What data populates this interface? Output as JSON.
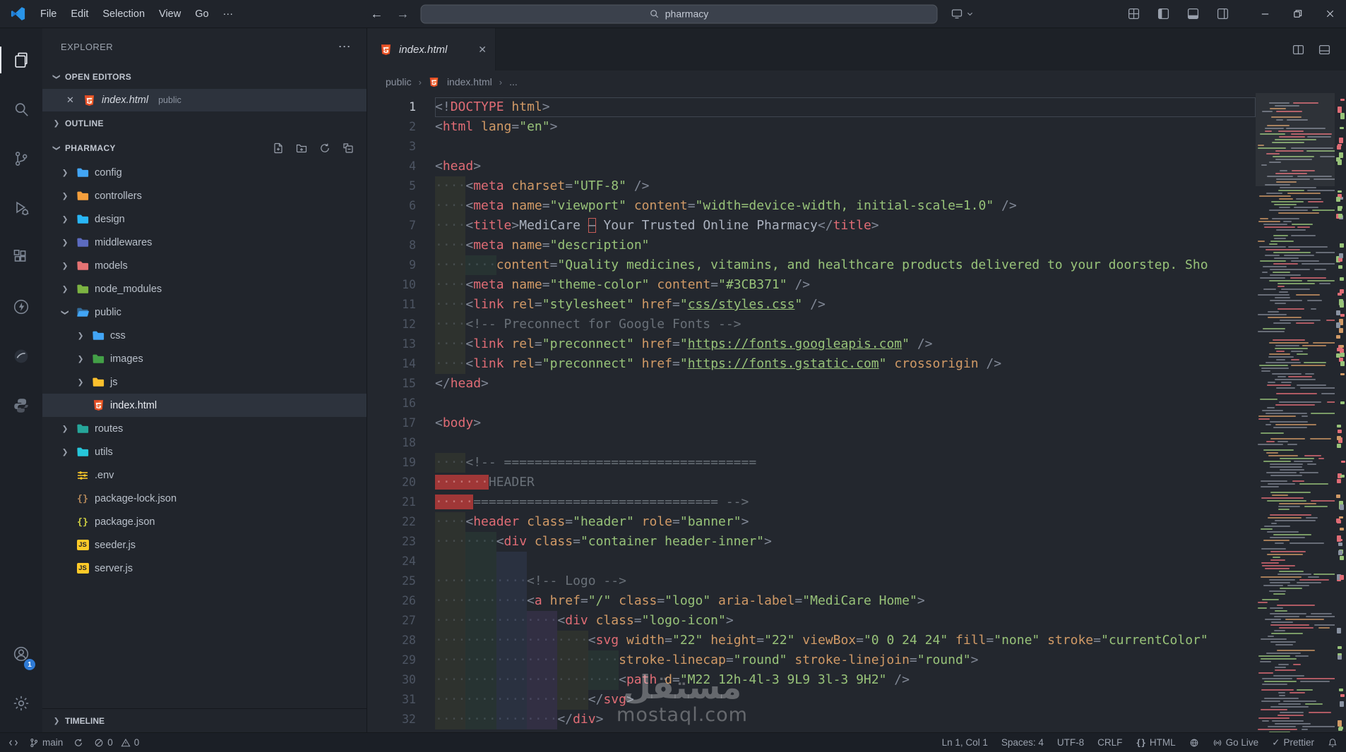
{
  "icons": {
    "more": "⋯",
    "close": "✕",
    "check": "✓",
    "chevron": "❯",
    "bc_sep": "›",
    "back": "←",
    "forward": "→",
    "js_badge": "JS",
    "braces": "{}"
  },
  "colors": {
    "accent": "#2f7bd6",
    "html_orange": "#e44d26",
    "theme_green": "#3CB371"
  },
  "titlebar": {
    "menus": [
      "File",
      "Edit",
      "Selection",
      "View",
      "Go"
    ],
    "more_label": "···",
    "search": {
      "value": "pharmacy"
    }
  },
  "activity_bar": {
    "badge": "1"
  },
  "sidebar": {
    "title": "EXPLORER",
    "open_editors": {
      "label": "OPEN EDITORS",
      "items": [
        {
          "name": "index.html",
          "detail": "public"
        }
      ]
    },
    "outline_label": "OUTLINE",
    "project_label": "PHARMACY",
    "timeline_label": "TIMELINE",
    "tree": [
      {
        "label": "config",
        "kind": "folder",
        "color": "#42a5f5",
        "depth": 0
      },
      {
        "label": "controllers",
        "kind": "folder",
        "color": "#f59f3c",
        "depth": 0
      },
      {
        "label": "design",
        "kind": "folder",
        "color": "#29b6f6",
        "depth": 0
      },
      {
        "label": "middlewares",
        "kind": "folder",
        "color": "#5c6bc0",
        "depth": 0
      },
      {
        "label": "models",
        "kind": "folder",
        "color": "#e57373",
        "depth": 0
      },
      {
        "label": "node_modules",
        "kind": "folder",
        "color": "#7cb342",
        "depth": 0
      },
      {
        "label": "public",
        "kind": "folder-open",
        "color": "#42a5f5",
        "depth": 0
      },
      {
        "label": "css",
        "kind": "folder",
        "color": "#42a5f5",
        "depth": 1
      },
      {
        "label": "images",
        "kind": "folder",
        "color": "#43a047",
        "depth": 1
      },
      {
        "label": "js",
        "kind": "folder",
        "color": "#fbc02d",
        "depth": 1
      },
      {
        "label": "index.html",
        "kind": "html",
        "depth": 1,
        "selected": true
      },
      {
        "label": "routes",
        "kind": "folder",
        "color": "#26a69a",
        "depth": 0
      },
      {
        "label": "utils",
        "kind": "folder",
        "color": "#26c6da",
        "depth": 0
      },
      {
        "label": ".env",
        "kind": "env",
        "depth": 0
      },
      {
        "label": "package-lock.json",
        "kind": "json-lock",
        "depth": 0
      },
      {
        "label": "package.json",
        "kind": "json",
        "depth": 0
      },
      {
        "label": "seeder.js",
        "kind": "js",
        "depth": 0
      },
      {
        "label": "server.js",
        "kind": "js",
        "depth": 0
      }
    ]
  },
  "editor": {
    "tab": {
      "label": "index.html"
    },
    "breadcrumb": {
      "root": "public",
      "file": "index.html",
      "more": "..."
    },
    "lines": [
      [
        [
          "p",
          "<!"
        ],
        [
          "t",
          "DOCTYPE"
        ],
        [
          "x",
          " "
        ],
        [
          "a",
          "html"
        ],
        [
          "p",
          ">"
        ]
      ],
      [
        [
          "p",
          "<"
        ],
        [
          "t",
          "html"
        ],
        [
          "x",
          " "
        ],
        [
          "a",
          "lang"
        ],
        [
          "p",
          "="
        ],
        [
          "s",
          "\"en\""
        ],
        [
          "p",
          ">"
        ]
      ],
      [],
      [
        [
          "p",
          "<"
        ],
        [
          "t",
          "head"
        ],
        [
          "p",
          ">"
        ]
      ],
      [
        [
          "w",
          "····"
        ],
        [
          "p",
          "<"
        ],
        [
          "t",
          "meta"
        ],
        [
          "x",
          " "
        ],
        [
          "a",
          "charset"
        ],
        [
          "p",
          "="
        ],
        [
          "s",
          "\"UTF-8\""
        ],
        [
          "x",
          " "
        ],
        [
          "p",
          "/>"
        ]
      ],
      [
        [
          "w",
          "····"
        ],
        [
          "p",
          "<"
        ],
        [
          "t",
          "meta"
        ],
        [
          "x",
          " "
        ],
        [
          "a",
          "name"
        ],
        [
          "p",
          "="
        ],
        [
          "s",
          "\"viewport\""
        ],
        [
          "x",
          " "
        ],
        [
          "a",
          "content"
        ],
        [
          "p",
          "="
        ],
        [
          "s",
          "\"width=device-width, initial-scale=1.0\""
        ],
        [
          "x",
          " "
        ],
        [
          "p",
          "/>"
        ]
      ],
      [
        [
          "w",
          "····"
        ],
        [
          "p",
          "<"
        ],
        [
          "t",
          "title"
        ],
        [
          "p",
          ">"
        ],
        [
          "x",
          "MediCare "
        ],
        [
          "h",
          "–"
        ],
        [
          "x",
          " Your Trusted Online Pharmacy"
        ],
        [
          "p",
          "</"
        ],
        [
          "t",
          "title"
        ],
        [
          "p",
          ">"
        ]
      ],
      [
        [
          "w",
          "····"
        ],
        [
          "p",
          "<"
        ],
        [
          "t",
          "meta"
        ],
        [
          "x",
          " "
        ],
        [
          "a",
          "name"
        ],
        [
          "p",
          "="
        ],
        [
          "s",
          "\"description\""
        ]
      ],
      [
        [
          "w",
          "········"
        ],
        [
          "a",
          "content"
        ],
        [
          "p",
          "="
        ],
        [
          "s",
          "\"Quality medicines, vitamins, and healthcare products delivered to your doorstep. Sho"
        ]
      ],
      [
        [
          "w",
          "····"
        ],
        [
          "p",
          "<"
        ],
        [
          "t",
          "meta"
        ],
        [
          "x",
          " "
        ],
        [
          "a",
          "name"
        ],
        [
          "p",
          "="
        ],
        [
          "s",
          "\"theme-color\""
        ],
        [
          "x",
          " "
        ],
        [
          "a",
          "content"
        ],
        [
          "p",
          "="
        ],
        [
          "s",
          "\"#3CB371\""
        ],
        [
          "x",
          " "
        ],
        [
          "p",
          "/>"
        ]
      ],
      [
        [
          "w",
          "····"
        ],
        [
          "p",
          "<"
        ],
        [
          "t",
          "link"
        ],
        [
          "x",
          " "
        ],
        [
          "a",
          "rel"
        ],
        [
          "p",
          "="
        ],
        [
          "s",
          "\"stylesheet\""
        ],
        [
          "x",
          " "
        ],
        [
          "a",
          "href"
        ],
        [
          "p",
          "="
        ],
        [
          "s",
          "\""
        ],
        [
          "u",
          "css/styles.css"
        ],
        [
          "s",
          "\""
        ],
        [
          "x",
          " "
        ],
        [
          "p",
          "/>"
        ]
      ],
      [
        [
          "w",
          "····"
        ],
        [
          "c",
          "<!-- Preconnect for Google Fonts -->"
        ]
      ],
      [
        [
          "w",
          "····"
        ],
        [
          "p",
          "<"
        ],
        [
          "t",
          "link"
        ],
        [
          "x",
          " "
        ],
        [
          "a",
          "rel"
        ],
        [
          "p",
          "="
        ],
        [
          "s",
          "\"preconnect\""
        ],
        [
          "x",
          " "
        ],
        [
          "a",
          "href"
        ],
        [
          "p",
          "="
        ],
        [
          "s",
          "\""
        ],
        [
          "u",
          "https://fonts.googleapis.com"
        ],
        [
          "s",
          "\""
        ],
        [
          "x",
          " "
        ],
        [
          "p",
          "/>"
        ]
      ],
      [
        [
          "w",
          "····"
        ],
        [
          "p",
          "<"
        ],
        [
          "t",
          "link"
        ],
        [
          "x",
          " "
        ],
        [
          "a",
          "rel"
        ],
        [
          "p",
          "="
        ],
        [
          "s",
          "\"preconnect\""
        ],
        [
          "x",
          " "
        ],
        [
          "a",
          "href"
        ],
        [
          "p",
          "="
        ],
        [
          "s",
          "\""
        ],
        [
          "u",
          "https://fonts.gstatic.com"
        ],
        [
          "s",
          "\""
        ],
        [
          "x",
          " "
        ],
        [
          "a",
          "crossorigin"
        ],
        [
          "x",
          " "
        ],
        [
          "p",
          "/>"
        ]
      ],
      [
        [
          "p",
          "</"
        ],
        [
          "t",
          "head"
        ],
        [
          "p",
          ">"
        ]
      ],
      [],
      [
        [
          "p",
          "<"
        ],
        [
          "t",
          "body"
        ],
        [
          "p",
          ">"
        ]
      ],
      [],
      [
        [
          "w",
          "····"
        ],
        [
          "c",
          "<!-- ================================="
        ]
      ],
      [
        [
          "we",
          "·······"
        ],
        [
          "c",
          "HEADER"
        ]
      ],
      [
        [
          "we",
          "·····"
        ],
        [
          "c",
          "================================ -->"
        ]
      ],
      [
        [
          "w",
          "····"
        ],
        [
          "p",
          "<"
        ],
        [
          "t",
          "header"
        ],
        [
          "x",
          " "
        ],
        [
          "a",
          "class"
        ],
        [
          "p",
          "="
        ],
        [
          "s",
          "\"header\""
        ],
        [
          "x",
          " "
        ],
        [
          "a",
          "role"
        ],
        [
          "p",
          "="
        ],
        [
          "s",
          "\"banner\""
        ],
        [
          "p",
          ">"
        ]
      ],
      [
        [
          "w",
          "········"
        ],
        [
          "p",
          "<"
        ],
        [
          "t",
          "div"
        ],
        [
          "x",
          " "
        ],
        [
          "a",
          "class"
        ],
        [
          "p",
          "="
        ],
        [
          "s",
          "\"container header-inner\""
        ],
        [
          "p",
          ">"
        ]
      ],
      [
        [
          "w0",
          "············"
        ]
      ],
      [
        [
          "w",
          "············"
        ],
        [
          "c",
          "<!-- Logo -->"
        ]
      ],
      [
        [
          "w",
          "············"
        ],
        [
          "p",
          "<"
        ],
        [
          "t",
          "a"
        ],
        [
          "x",
          " "
        ],
        [
          "a",
          "href"
        ],
        [
          "p",
          "="
        ],
        [
          "s",
          "\"/\""
        ],
        [
          "x",
          " "
        ],
        [
          "a",
          "class"
        ],
        [
          "p",
          "="
        ],
        [
          "s",
          "\"logo\""
        ],
        [
          "x",
          " "
        ],
        [
          "a",
          "aria-label"
        ],
        [
          "p",
          "="
        ],
        [
          "s",
          "\"MediCare Home\""
        ],
        [
          "p",
          ">"
        ]
      ],
      [
        [
          "w",
          "················"
        ],
        [
          "p",
          "<"
        ],
        [
          "t",
          "div"
        ],
        [
          "x",
          " "
        ],
        [
          "a",
          "class"
        ],
        [
          "p",
          "="
        ],
        [
          "s",
          "\"logo-icon\""
        ],
        [
          "p",
          ">"
        ]
      ],
      [
        [
          "w",
          "····················"
        ],
        [
          "p",
          "<"
        ],
        [
          "t",
          "svg"
        ],
        [
          "x",
          " "
        ],
        [
          "a",
          "width"
        ],
        [
          "p",
          "="
        ],
        [
          "s",
          "\"22\""
        ],
        [
          "x",
          " "
        ],
        [
          "a",
          "height"
        ],
        [
          "p",
          "="
        ],
        [
          "s",
          "\"22\""
        ],
        [
          "x",
          " "
        ],
        [
          "a",
          "viewBox"
        ],
        [
          "p",
          "="
        ],
        [
          "s",
          "\"0 0 24 24\""
        ],
        [
          "x",
          " "
        ],
        [
          "a",
          "fill"
        ],
        [
          "p",
          "="
        ],
        [
          "s",
          "\"none\""
        ],
        [
          "x",
          " "
        ],
        [
          "a",
          "stroke"
        ],
        [
          "p",
          "="
        ],
        [
          "s",
          "\"currentColor\""
        ]
      ],
      [
        [
          "w",
          "························"
        ],
        [
          "a",
          "stroke-linecap"
        ],
        [
          "p",
          "="
        ],
        [
          "s",
          "\"round\""
        ],
        [
          "x",
          " "
        ],
        [
          "a",
          "stroke-linejoin"
        ],
        [
          "p",
          "="
        ],
        [
          "s",
          "\"round\""
        ],
        [
          "p",
          ">"
        ]
      ],
      [
        [
          "w",
          "························"
        ],
        [
          "p",
          "<"
        ],
        [
          "t",
          "path"
        ],
        [
          "x",
          " "
        ],
        [
          "a",
          "d"
        ],
        [
          "p",
          "="
        ],
        [
          "s",
          "\"M22 12h-4l-3 9L9 3l-3 9H2\""
        ],
        [
          "x",
          " "
        ],
        [
          "p",
          "/>"
        ]
      ],
      [
        [
          "w",
          "····················"
        ],
        [
          "p",
          "</"
        ],
        [
          "t",
          "svg"
        ],
        [
          "p",
          ">"
        ]
      ],
      [
        [
          "w",
          "················"
        ],
        [
          "p",
          "</"
        ],
        [
          "t",
          "div"
        ],
        [
          "p",
          ">"
        ]
      ]
    ]
  },
  "statusbar": {
    "branch": "main",
    "errors": "0",
    "warnings": "0",
    "line_col": "Ln 1, Col 1",
    "spaces": "Spaces: 4",
    "encoding": "UTF-8",
    "eol": "CRLF",
    "lang": "HTML",
    "go_live": "Go Live",
    "prettier": "Prettier"
  },
  "watermark": {
    "arabic": "مستقل",
    "latin": "mostaql.com"
  }
}
